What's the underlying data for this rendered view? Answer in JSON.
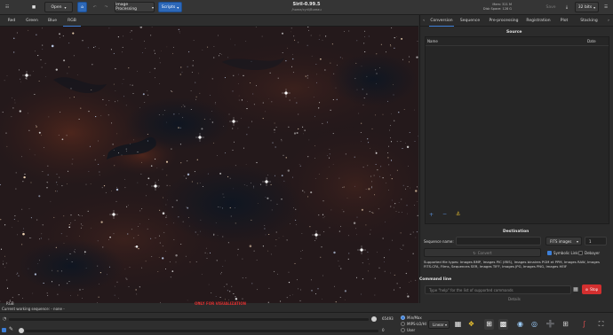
{
  "header": {
    "open_label": "Open",
    "image_processing_label": "Image Processing",
    "scripts_label": "Scripts",
    "app_title": "Siril-0.99.5",
    "subtitle": "/home/cyril/Bureau",
    "mem_label": "Mem: 321 M",
    "disk_label": "Disk Space: 128 G",
    "save_label": "Save",
    "bits_label": "32 bits"
  },
  "channel_tabs": [
    "Red",
    "Green",
    "Blue",
    "RGB"
  ],
  "active_channel": "RGB",
  "viewport": {
    "channel_label": "RGB",
    "warning": "ONLY FOR VISUALIZATION"
  },
  "right_tabs": [
    "Conversion",
    "Sequence",
    "Pre-processing",
    "Registration",
    "Plot",
    "Stacking"
  ],
  "active_right_tab": "Conversion",
  "source": {
    "title": "Source",
    "col_name": "Name",
    "col_date": "Date"
  },
  "destination": {
    "title": "Destination",
    "seq_name_label": "Sequence name:",
    "format": "FITS images",
    "start_index": "1",
    "convert_label": "Convert",
    "symbolic_link_label": "Symbolic Link",
    "debayer_label": "Debayer",
    "supported_label": "Supported file types:",
    "supported_types": "Images BMP, Images PIC (IRIS), Images binaires PGM et PPM, Images RAW, Images FITS-CFA, Films, Sequences SER, Images TIFF, Images JPG, Images PNG, Images HEIF"
  },
  "command_line": {
    "title": "Command line",
    "placeholder": "Type \"help\" for the list of supported commands",
    "stop_label": "Stop",
    "details_label": "Details"
  },
  "status": {
    "working_sequence": "Current working sequence: - none -"
  },
  "bottom": {
    "lo_value": "0",
    "hi_value": "65493",
    "minmax_label": "Min/Max",
    "mips_label": "MIPS-LO/HI",
    "user_label": "User",
    "scale_mode": "Linear"
  },
  "colors": {
    "accent": "#3d7fd8",
    "stop_red": "#d32f2f",
    "warning_red": "#e03030"
  }
}
